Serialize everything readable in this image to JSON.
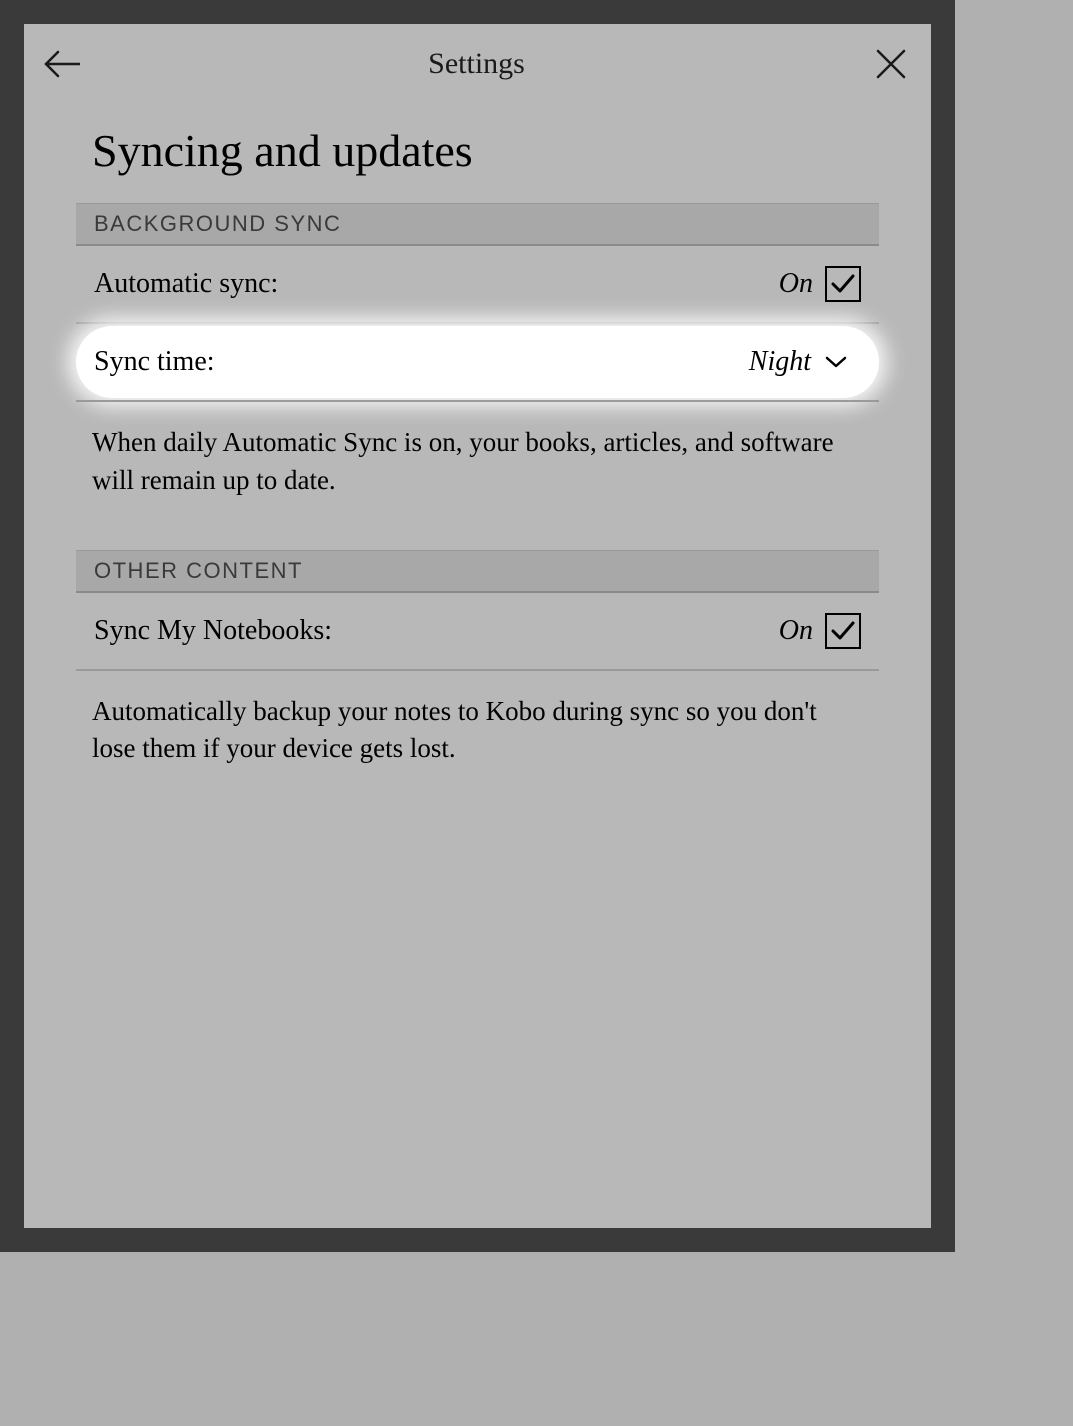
{
  "header": {
    "title": "Settings"
  },
  "page": {
    "title": "Syncing and updates"
  },
  "sections": {
    "background_sync": {
      "header": "BACKGROUND SYNC",
      "auto_sync": {
        "label": "Automatic sync:",
        "value": "On"
      },
      "sync_time": {
        "label": "Sync time:",
        "value": "Night"
      },
      "description": "When daily Automatic Sync is on, your books, articles, and software will remain up to date."
    },
    "other_content": {
      "header": "OTHER CONTENT",
      "sync_notebooks": {
        "label": "Sync My Notebooks:",
        "value": "On"
      },
      "description": "Automatically backup your notes to Kobo during sync so you don't lose them if your device gets lost."
    }
  }
}
